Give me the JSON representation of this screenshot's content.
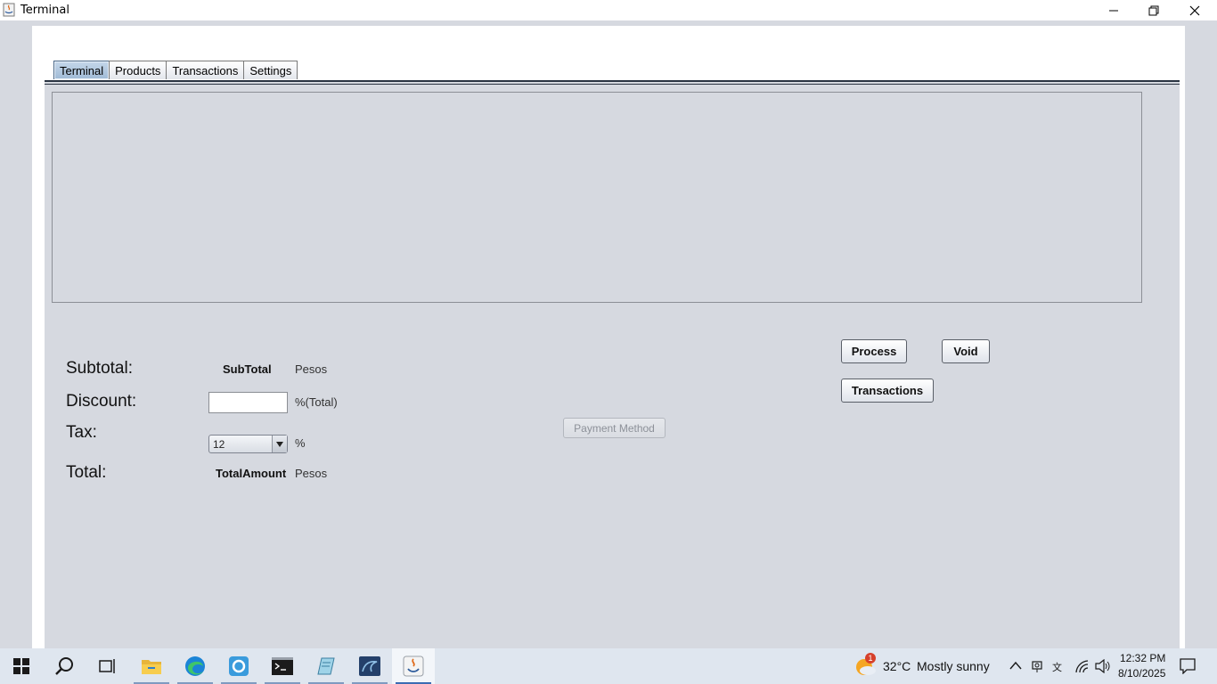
{
  "window": {
    "title": "Terminal",
    "icon": "java-icon",
    "controls": [
      "minimize-icon",
      "restore-icon",
      "close-icon"
    ]
  },
  "tabs": [
    {
      "label": "Terminal",
      "active": true
    },
    {
      "label": "Products",
      "active": false
    },
    {
      "label": "Transactions",
      "active": false
    },
    {
      "label": "Settings",
      "active": false
    }
  ],
  "summary": {
    "subtotal_label": "Subtotal:",
    "subtotal_value": "SubTotal",
    "subtotal_unit": "Pesos",
    "discount_label": "Discount:",
    "discount_value": "",
    "discount_unit": "%(Total)",
    "tax_label": "Tax:",
    "tax_selected": "12",
    "tax_unit": "%",
    "total_label": "Total:",
    "total_value": "TotalAmount",
    "total_unit": "Pesos"
  },
  "actions": {
    "payment_method": "Payment Method",
    "process": "Process",
    "void": "Void",
    "transactions": "Transactions"
  },
  "taskbar": {
    "apps": [
      "start-icon",
      "search-icon",
      "task-view-icon",
      "file-explorer-icon",
      "edge-icon",
      "app-icon",
      "terminal-icon",
      "notepad-icon",
      "mysql-workbench-icon",
      "java-icon"
    ],
    "weather_temp": "32°C",
    "weather_text": "Mostly sunny",
    "weather_badge": "1",
    "time": "12:32 PM",
    "date": "8/10/2025"
  }
}
